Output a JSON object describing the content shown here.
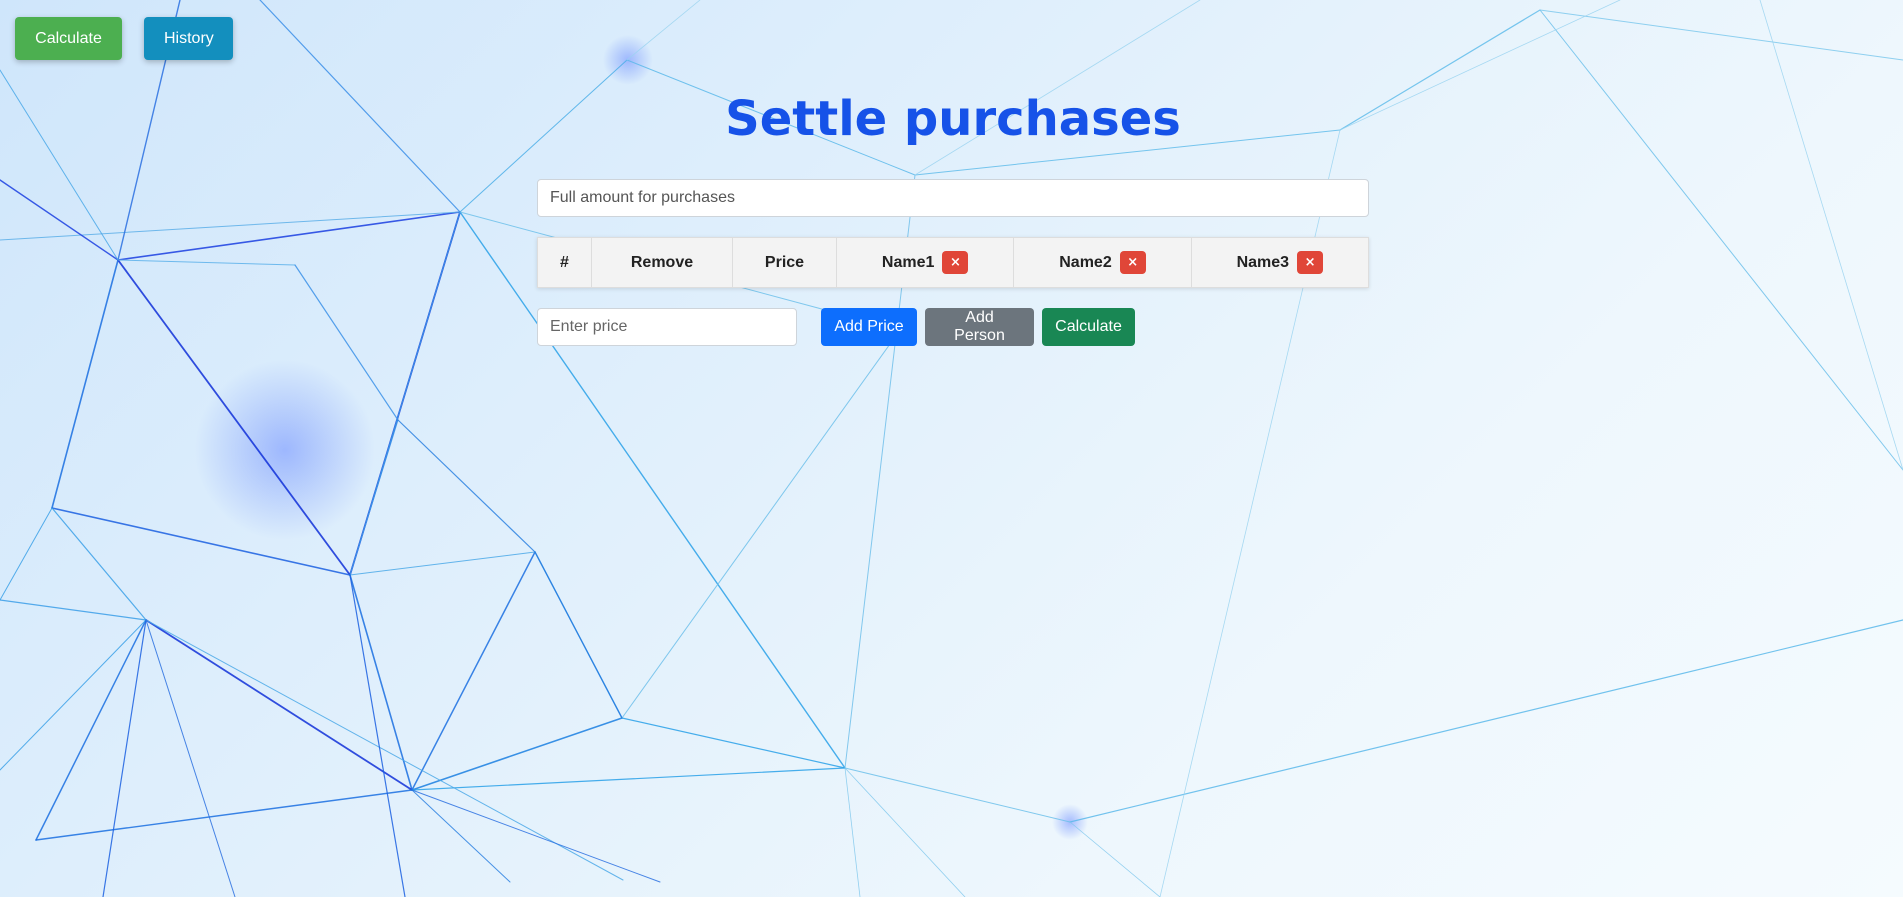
{
  "topbar": {
    "calculate_label": "Calculate",
    "history_label": "History"
  },
  "main": {
    "title": "Settle purchases",
    "amount_placeholder": "Full amount for purchases",
    "table": {
      "headers": {
        "number": "#",
        "remove": "Remove",
        "price": "Price"
      },
      "people": [
        "Name1",
        "Name2",
        "Name3"
      ],
      "remove_person_icon": "×"
    },
    "controls": {
      "price_placeholder": "Enter price",
      "add_price_label": "Add Price",
      "add_person_label": "Add Person",
      "calculate_label": "Calculate"
    }
  },
  "colors": {
    "title": "#1652e8",
    "nav_calculate": "#4caf50",
    "nav_history": "#138fbe",
    "add_price": "#0d6efd",
    "add_person": "#6c757d",
    "calculate": "#198754",
    "remove_person": "#e04638"
  },
  "icons": {
    "remove_person": "close-icon"
  }
}
